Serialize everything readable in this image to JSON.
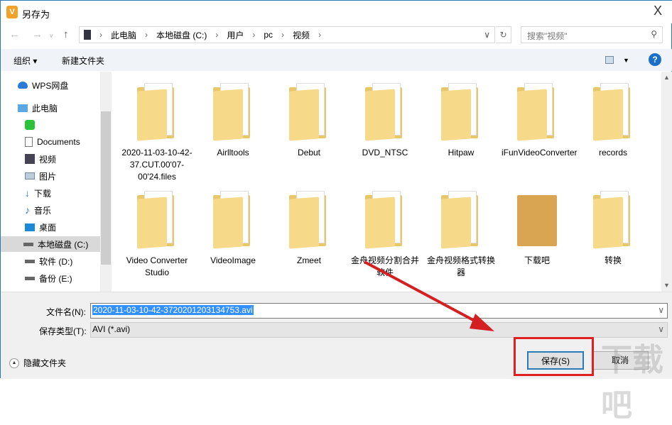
{
  "window": {
    "title": "另存为",
    "close": "X"
  },
  "address": {
    "path": [
      "此电脑",
      "本地磁盘 (C:)",
      "用户",
      "pc",
      "视频"
    ],
    "search_placeholder": "搜索\"视频\""
  },
  "toolbar": {
    "organize": "组织 ▾",
    "new_folder": "新建文件夹",
    "help": "?"
  },
  "sidebar": {
    "items": [
      {
        "label": "WPS网盘",
        "icon": "cloud-icon"
      },
      {
        "label": "此电脑",
        "icon": "computer-icon"
      },
      {
        "label": "",
        "icon": "app-icon"
      },
      {
        "label": "Documents",
        "icon": "document-icon"
      },
      {
        "label": "视频",
        "icon": "video-icon"
      },
      {
        "label": "图片",
        "icon": "picture-icon"
      },
      {
        "label": "下载",
        "icon": "download-icon"
      },
      {
        "label": "音乐",
        "icon": "music-icon"
      },
      {
        "label": "桌面",
        "icon": "desktop-icon"
      },
      {
        "label": "本地磁盘 (C:)",
        "icon": "drive-icon"
      },
      {
        "label": "软件 (D:)",
        "icon": "drive-icon"
      },
      {
        "label": "备份 (E:)",
        "icon": "drive-icon"
      }
    ]
  },
  "files": [
    "2020-11-03-10-42-37.CUT.00'07-00'24.files",
    "Airlltools",
    "Debut",
    "DVD_NTSC",
    "Hitpaw",
    "iFunVideoConverter",
    "records",
    "Video Converter Studio",
    "VideoImage",
    "Zmeet",
    "金舟视频分割合并软件",
    "金舟视频格式转换器",
    "下载吧",
    "转换"
  ],
  "form": {
    "filename_label": "文件名(N):",
    "filename": "2020-11-03-10-42-3720201203134753.avi",
    "type_label": "保存类型(T):",
    "type": "AVI (*.avi)"
  },
  "footer": {
    "hide_folders": "隐藏文件夹",
    "save": "保存(S)",
    "cancel": "取消"
  },
  "watermark": "下载吧"
}
